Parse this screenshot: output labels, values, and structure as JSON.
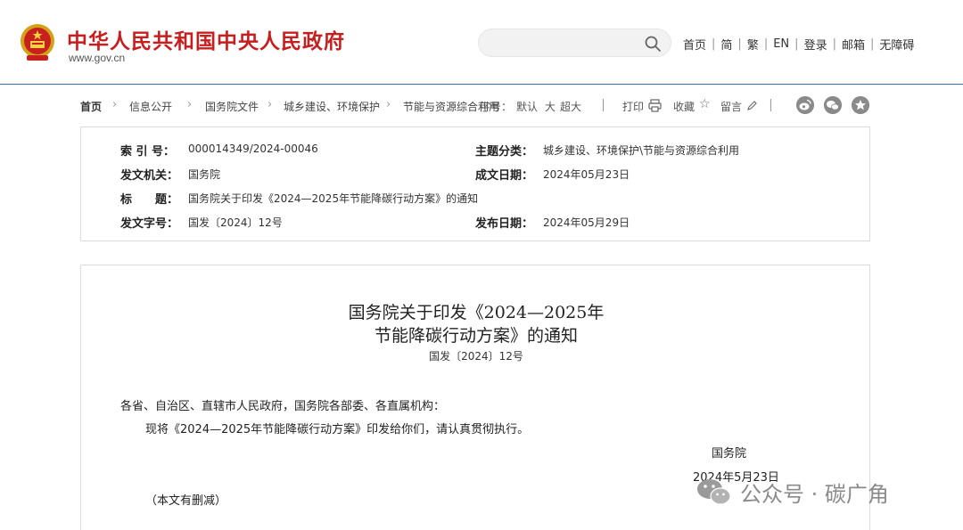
{
  "header": {
    "site_title": "中华人民共和国中央人民政府",
    "site_url": "www.gov.cn",
    "search_placeholder": "",
    "links": [
      "首页",
      "简",
      "繁",
      "EN",
      "登录",
      "邮箱",
      "无障碍"
    ]
  },
  "breadcrumb": {
    "items": [
      "首页",
      "信息公开",
      "国务院文件",
      "城乡建设、环境保护",
      "节能与资源综合利用"
    ]
  },
  "toolbar": {
    "font_label": "字号：",
    "font_default": "默认",
    "font_large": "大",
    "font_xlarge": "超大",
    "print": "打印",
    "favorite": "收藏",
    "comment": "留言"
  },
  "info": {
    "index_label": "索 引 号：",
    "index_value": "000014349/2024-00046",
    "category_label": "主题分类：",
    "category_value": "城乡建设、环境保护\\节能与资源综合利用",
    "issuer_label": "发文机关：",
    "issuer_value": "国务院",
    "written_date_label": "成文日期：",
    "written_date_value": "2024年05月23日",
    "title_label": "标　　题：",
    "title_value": "国务院关于印发《2024—2025年节能降碳行动方案》的通知",
    "doc_no_label": "发文字号：",
    "doc_no_value": "国发〔2024〕12号",
    "publish_date_label": "发布日期：",
    "publish_date_value": "2024年05月29日"
  },
  "document": {
    "title_line1": "国务院关于印发《2024—2025年",
    "title_line2": "节能降碳行动方案》的通知",
    "number": "国发〔2024〕12号",
    "salutation": "各省、自治区、直辖市人民政府，国务院各部委、各直属机构：",
    "body": "现将《2024—2025年节能降碳行动方案》印发给你们，请认真贯彻执行。",
    "signer": "国务院",
    "date": "2024年5月23日",
    "note": "（本文有删减）"
  },
  "watermark": {
    "text": "公众号 · 碳广角"
  },
  "colors": {
    "brand_red": "#c81e1e",
    "accent_blue": "#2a5caa",
    "header_border": "#3a6fb0"
  }
}
